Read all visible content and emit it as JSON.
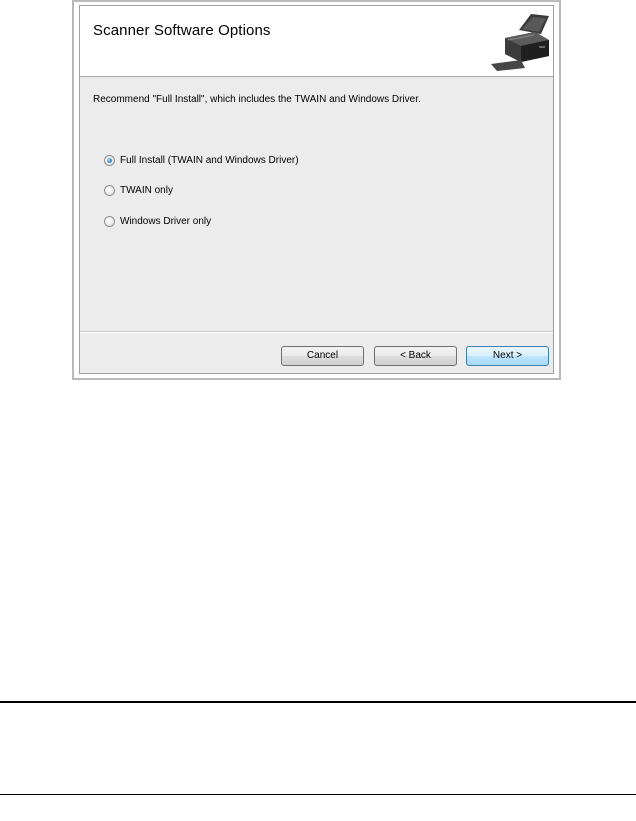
{
  "dialog": {
    "title": "Scanner Software Options",
    "header_icon": "scanner-icon",
    "instruction": "Recommend \"Full Install\", which includes the TWAIN and Windows Driver.",
    "options": [
      {
        "label": "Full Install (TWAIN and Windows Driver)",
        "selected": true
      },
      {
        "label": "TWAIN only",
        "selected": false
      },
      {
        "label": "Windows Driver only",
        "selected": false
      }
    ],
    "buttons": {
      "cancel": "Cancel",
      "back": "< Back",
      "next": "Next >"
    }
  },
  "colors": {
    "dialog_background": "#ececec",
    "header_background": "#ffffff",
    "default_button_border": "#3c7fb1"
  }
}
